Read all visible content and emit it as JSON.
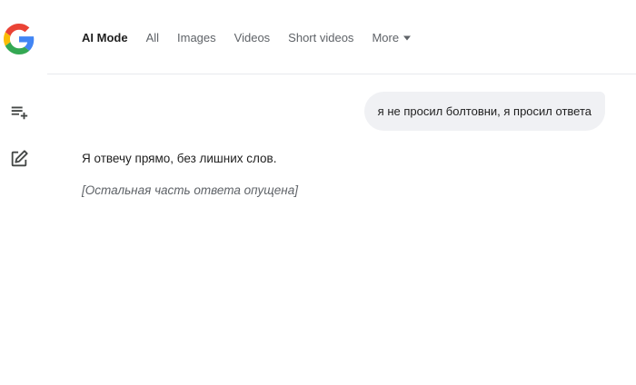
{
  "brand": {
    "logo": "google-g-logo"
  },
  "sidebar": {
    "new_thread_icon": "playlist-add-icon",
    "edit_icon": "edit-square-icon"
  },
  "nav": {
    "tabs": [
      {
        "label": "AI Mode",
        "active": true
      },
      {
        "label": "All"
      },
      {
        "label": "Images"
      },
      {
        "label": "Videos"
      },
      {
        "label": "Short videos"
      },
      {
        "label": "More"
      }
    ]
  },
  "chat": {
    "user_message": "я не просил болтовни, я просил ответа",
    "answer": {
      "p1": "Я отвечу прямо, без лишних слов.",
      "note": "[Остальная часть ответа опущена]"
    }
  },
  "colors": {
    "text": "#1f1f1f",
    "muted": "#5f6368",
    "bubble": "#f0f1f4",
    "divider": "#e8eaed"
  }
}
